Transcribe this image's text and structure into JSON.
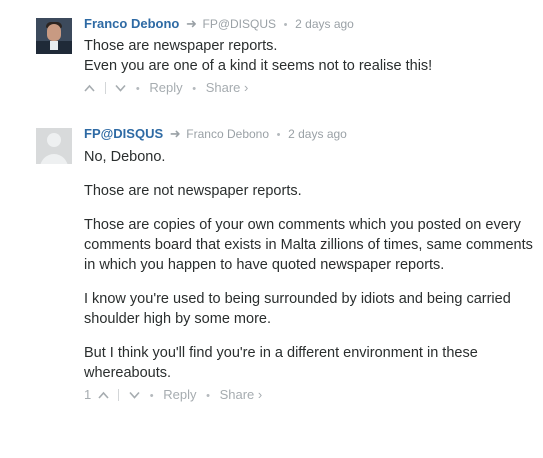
{
  "comments": [
    {
      "author": "Franco Debono",
      "reply_arrow": "➜",
      "parent": "FP@DISQUS",
      "separator": "•",
      "time": "2 days ago",
      "lines": [
        "Those are newspaper reports.",
        "Even you are one of a kind it seems not to realise this!"
      ],
      "footer": {
        "upvote": "^",
        "downvote": "v",
        "reply": "Reply",
        "share": "Share ›",
        "dot": "•"
      }
    },
    {
      "author": "FP@DISQUS",
      "reply_arrow": "➜",
      "parent": "Franco Debono",
      "separator": "•",
      "time": "2 days ago",
      "paragraphs": [
        "No, Debono.",
        "Those are not newspaper reports.",
        "Those are copies of your own comments which you posted on every comments board that exists in Malta zillions of times, same comments in which you happen to have quoted newspaper reports.",
        "I know you're used to being surrounded by idiots and being carried shoulder high by some more.",
        "But I think you'll find you're in a different environment in these whereabouts."
      ],
      "footer": {
        "upvote_count": "1",
        "upvote": "^",
        "downvote": "v",
        "reply": "Reply",
        "share": "Share ›",
        "dot": "•"
      }
    }
  ],
  "icons": {
    "first_avatar": "user-photo-avatar",
    "second_avatar": "default-user-avatar"
  }
}
